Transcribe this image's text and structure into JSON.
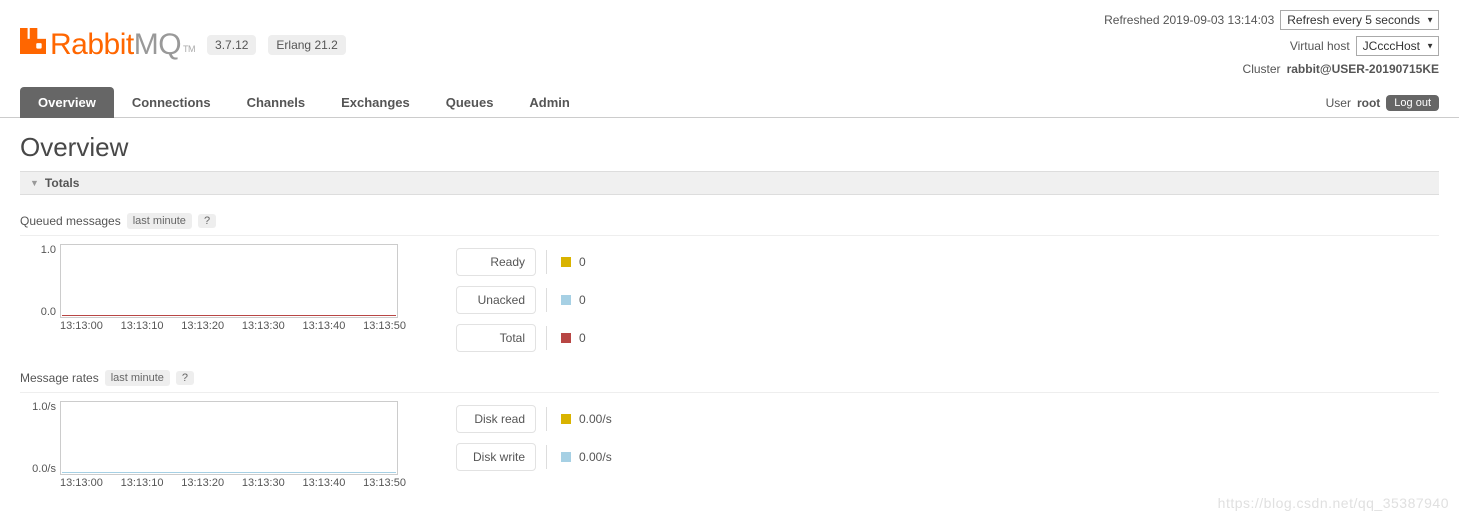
{
  "header": {
    "brand_rabbit": "Rabbit",
    "brand_mq": "MQ",
    "tm": "TM",
    "version": "3.7.12",
    "erlang": "Erlang 21.2",
    "refreshed_label": "Refreshed 2019-09-03 13:14:03",
    "refresh_select": "Refresh every 5 seconds",
    "vhost_label": "Virtual host",
    "vhost_value": "JCcccHost",
    "cluster_label": "Cluster",
    "cluster_value": "rabbit@USER-20190715KE",
    "user_label": "User",
    "user_value": "root",
    "logout": "Log out"
  },
  "tabs": [
    {
      "label": "Overview",
      "active": true
    },
    {
      "label": "Connections",
      "active": false
    },
    {
      "label": "Channels",
      "active": false
    },
    {
      "label": "Exchanges",
      "active": false
    },
    {
      "label": "Queues",
      "active": false
    },
    {
      "label": "Admin",
      "active": false
    }
  ],
  "page_title": "Overview",
  "totals_label": "Totals",
  "queued": {
    "title": "Queued messages",
    "range": "last minute",
    "help": "?",
    "ylabels": [
      "1.0",
      "0.0"
    ],
    "xlabels": [
      "13:13:00",
      "13:13:10",
      "13:13:20",
      "13:13:30",
      "13:13:40",
      "13:13:50"
    ],
    "legend": [
      {
        "name": "Ready",
        "color": "#d9b300",
        "value": "0"
      },
      {
        "name": "Unacked",
        "color": "#a6d0e4",
        "value": "0"
      },
      {
        "name": "Total",
        "color": "#b84644",
        "value": "0"
      }
    ]
  },
  "rates": {
    "title": "Message rates",
    "range": "last minute",
    "help": "?",
    "ylabels": [
      "1.0/s",
      "0.0/s"
    ],
    "xlabels": [
      "13:13:00",
      "13:13:10",
      "13:13:20",
      "13:13:30",
      "13:13:40",
      "13:13:50"
    ],
    "legend": [
      {
        "name": "Disk read",
        "color": "#d9b300",
        "value": "0.00/s"
      },
      {
        "name": "Disk write",
        "color": "#a6d0e4",
        "value": "0.00/s"
      }
    ]
  },
  "chart_data": [
    {
      "type": "line",
      "title": "Queued messages (last minute)",
      "x": [
        "13:13:00",
        "13:13:10",
        "13:13:20",
        "13:13:30",
        "13:13:40",
        "13:13:50"
      ],
      "series": [
        {
          "name": "Ready",
          "values": [
            0,
            0,
            0,
            0,
            0,
            0
          ]
        },
        {
          "name": "Unacked",
          "values": [
            0,
            0,
            0,
            0,
            0,
            0
          ]
        },
        {
          "name": "Total",
          "values": [
            0,
            0,
            0,
            0,
            0,
            0
          ]
        }
      ],
      "ylim": [
        0,
        1
      ],
      "ylabel": "",
      "xlabel": ""
    },
    {
      "type": "line",
      "title": "Message rates (last minute)",
      "x": [
        "13:13:00",
        "13:13:10",
        "13:13:20",
        "13:13:30",
        "13:13:40",
        "13:13:50"
      ],
      "series": [
        {
          "name": "Disk read",
          "values": [
            0,
            0,
            0,
            0,
            0,
            0
          ]
        },
        {
          "name": "Disk write",
          "values": [
            0,
            0,
            0,
            0,
            0,
            0
          ]
        }
      ],
      "ylim": [
        0,
        1
      ],
      "ylabel": "/s",
      "xlabel": ""
    }
  ],
  "watermark": "https://blog.csdn.net/qq_35387940"
}
